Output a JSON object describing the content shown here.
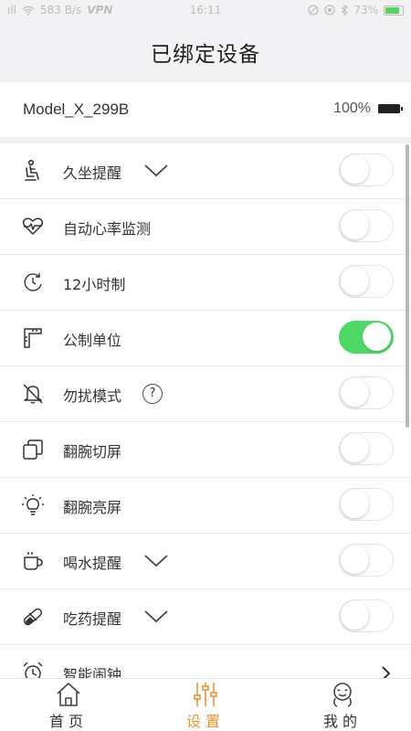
{
  "status_bar": {
    "signal": "ıll",
    "speed": "583 B/s",
    "vpn": "VPN",
    "time": "16:11",
    "battery": "73%"
  },
  "header": {
    "title": "已绑定设备"
  },
  "device": {
    "name": "Model_X_299B",
    "battery": "100%"
  },
  "settings": [
    {
      "label": "久坐提醒",
      "icon": "sitting-person-icon",
      "on": false,
      "dropdown": true
    },
    {
      "label": "自动心率监测",
      "icon": "heart-rate-icon",
      "on": false
    },
    {
      "label": "12小时制",
      "icon": "clock-12h-icon",
      "on": false
    },
    {
      "label": "公制单位",
      "icon": "ruler-icon",
      "on": true
    },
    {
      "label": "勿扰模式",
      "icon": "bell-off-icon",
      "on": false,
      "help": "?"
    },
    {
      "label": "翻腕切屏",
      "icon": "screen-switch-icon",
      "on": false
    },
    {
      "label": "翻腕亮屏",
      "icon": "lightbulb-icon",
      "on": false
    },
    {
      "label": "喝水提醒",
      "icon": "cup-icon",
      "on": false,
      "dropdown": true
    },
    {
      "label": "吃药提醒",
      "icon": "pill-icon",
      "on": false,
      "dropdown": true
    },
    {
      "label": "智能闹钟",
      "icon": "alarm-clock-icon",
      "arrow": true
    }
  ],
  "tabs": [
    {
      "label": "首页",
      "icon": "home-icon"
    },
    {
      "label": "设置",
      "icon": "sliders-icon",
      "active": true
    },
    {
      "label": "我的",
      "icon": "profile-icon"
    }
  ],
  "colors": {
    "toggle_on": "#4cd964",
    "tab_active": "#f0922b"
  }
}
